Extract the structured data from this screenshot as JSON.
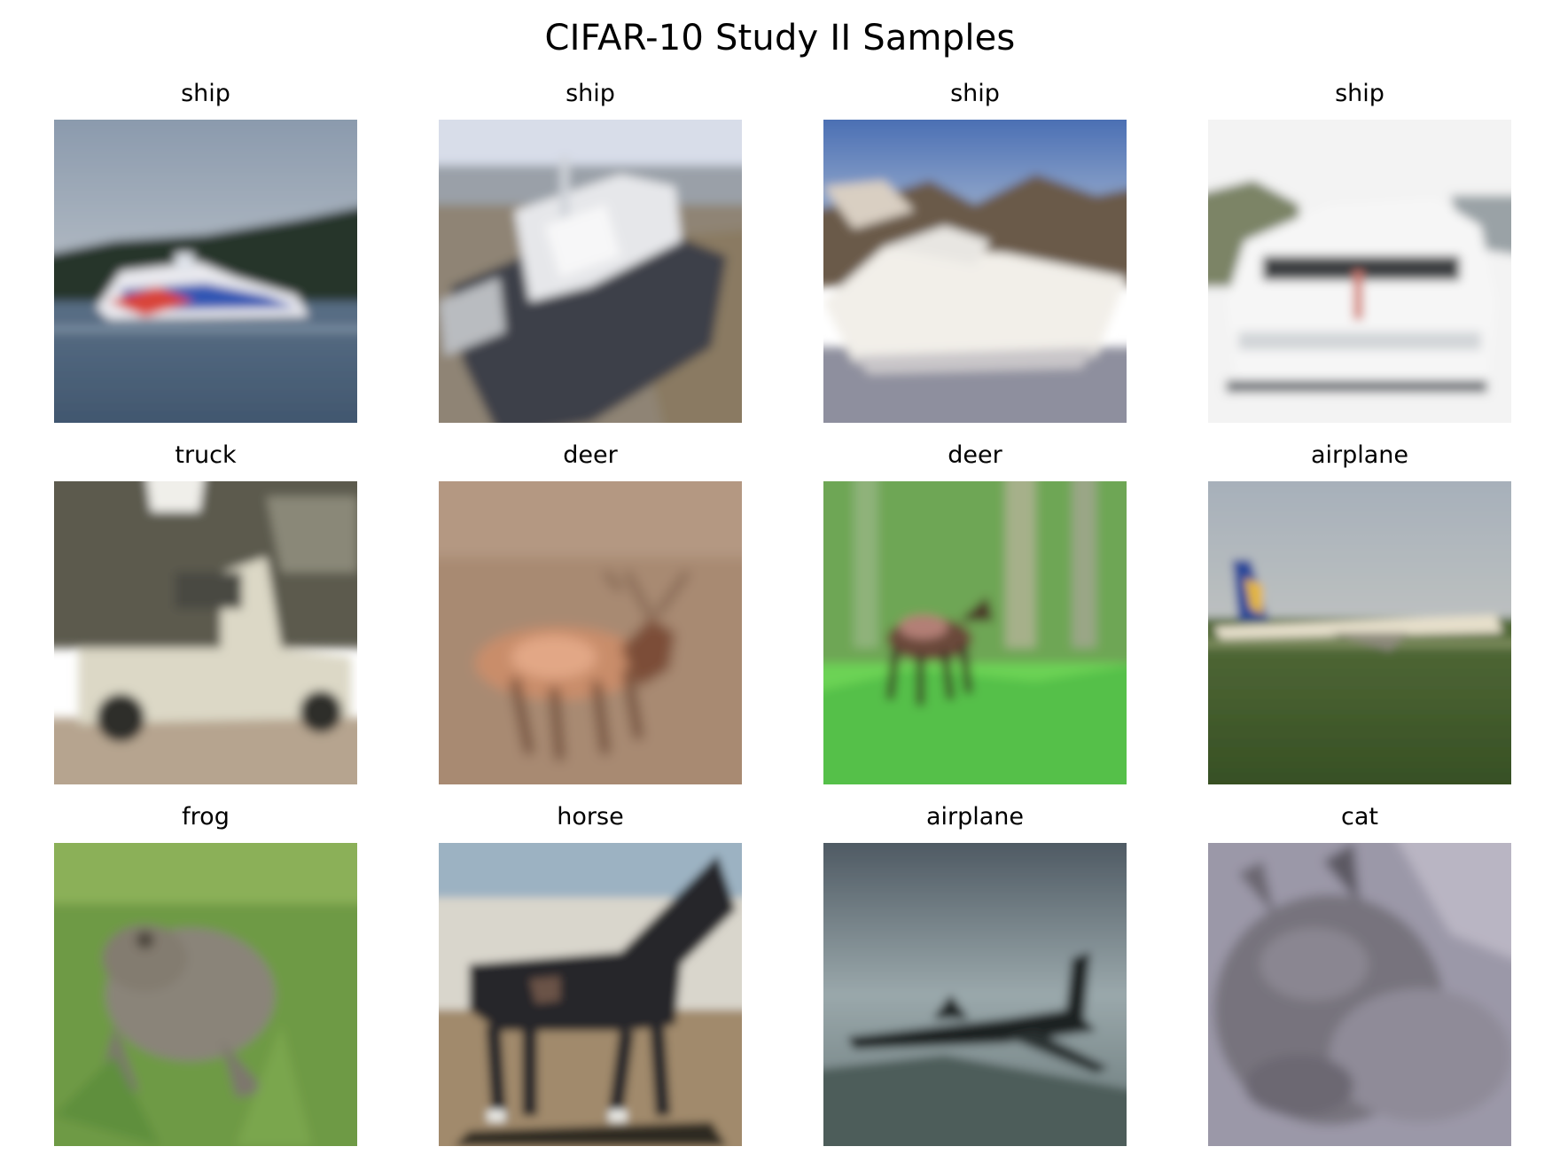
{
  "title": "CIFAR-10 Study II Samples",
  "samples": [
    {
      "label": "ship",
      "scene": "motorboat-on-water"
    },
    {
      "label": "ship",
      "scene": "dark-hull-ship-at-dock"
    },
    {
      "label": "ship",
      "scene": "white-yacht-by-shore"
    },
    {
      "label": "ship",
      "scene": "white-yacht-bright"
    },
    {
      "label": "truck",
      "scene": "white-utility-truck"
    },
    {
      "label": "deer",
      "scene": "deer-on-brown-field"
    },
    {
      "label": "deer",
      "scene": "deer-in-green-forest"
    },
    {
      "label": "airplane",
      "scene": "airliner-on-grass-runway"
    },
    {
      "label": "frog",
      "scene": "toad-in-grass"
    },
    {
      "label": "horse",
      "scene": "dark-horse-standing"
    },
    {
      "label": "airplane",
      "scene": "jet-silhouette-over-sea"
    },
    {
      "label": "cat",
      "scene": "grey-cat-lying"
    }
  ]
}
